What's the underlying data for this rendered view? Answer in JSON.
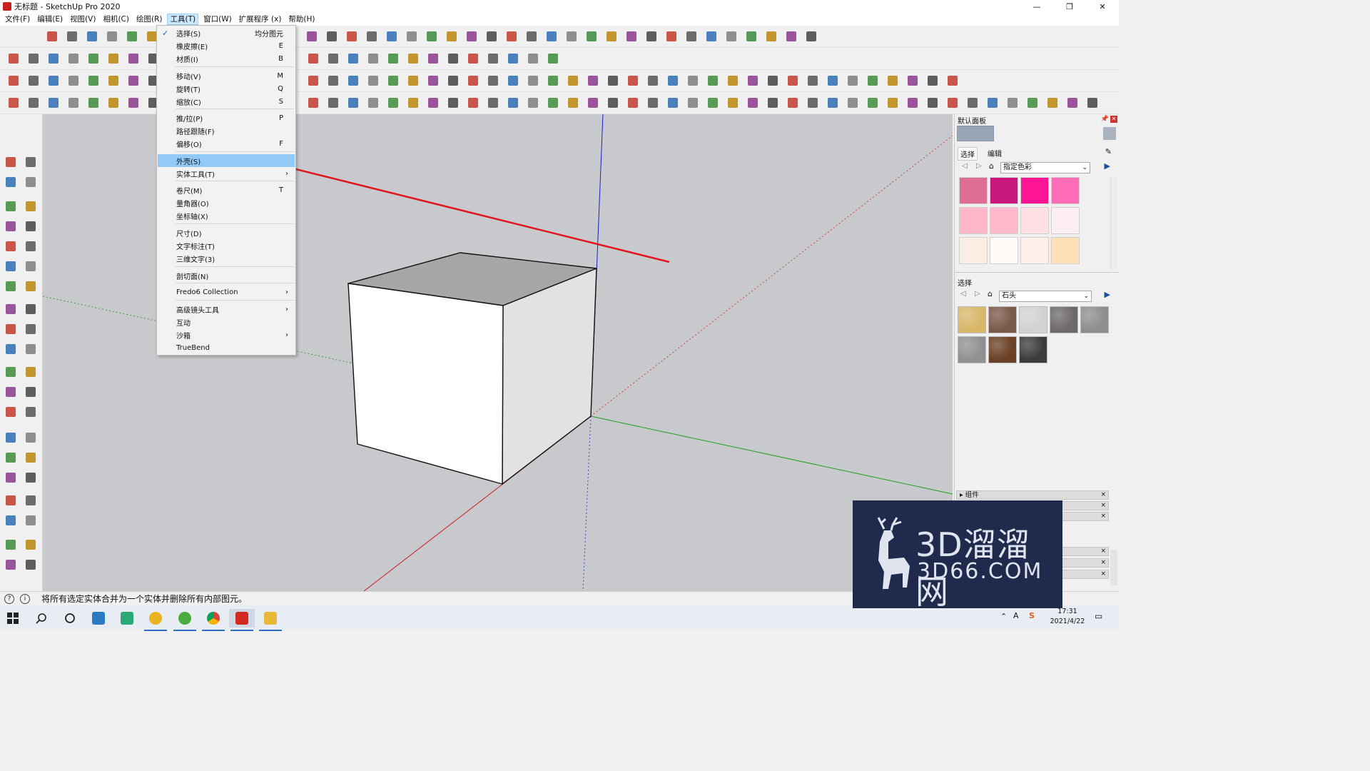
{
  "window": {
    "title": "无标题 - SketchUp Pro 2020",
    "minimize_glyph": "—",
    "restore_glyph": "❐",
    "close_glyph": "✕"
  },
  "menubar": [
    {
      "label": "文件(F)"
    },
    {
      "label": "编辑(E)"
    },
    {
      "label": "视图(V)"
    },
    {
      "label": "相机(C)"
    },
    {
      "label": "绘图(R)"
    },
    {
      "label": "工具(T)",
      "active": true
    },
    {
      "label": "窗口(W)"
    },
    {
      "label": "扩展程序 (x)"
    },
    {
      "label": "帮助(H)"
    }
  ],
  "tools_menu": {
    "items": [
      {
        "label": "选择(S)",
        "shortcut": "均分图元",
        "checked": true
      },
      {
        "label": "橡皮擦(E)",
        "shortcut": "E"
      },
      {
        "label": "材质(I)",
        "shortcut": "B"
      },
      {
        "label": "移动(V)",
        "shortcut": "M"
      },
      {
        "label": "旋转(T)",
        "shortcut": "Q"
      },
      {
        "label": "缩放(C)",
        "shortcut": "S"
      },
      {
        "label": "推/拉(P)",
        "shortcut": "P"
      },
      {
        "label": "路径跟随(F)",
        "shortcut": ""
      },
      {
        "label": "偏移(O)",
        "shortcut": "F"
      },
      {
        "label": "外壳(S)",
        "shortcut": "",
        "highlighted": true
      },
      {
        "label": "实体工具(T)",
        "shortcut": "",
        "submenu": true
      },
      {
        "label": "卷尺(M)",
        "shortcut": "T"
      },
      {
        "label": "量角器(O)",
        "shortcut": ""
      },
      {
        "label": "坐标轴(X)",
        "shortcut": ""
      },
      {
        "label": "尺寸(D)",
        "shortcut": ""
      },
      {
        "label": "文字标注(T)",
        "shortcut": ""
      },
      {
        "label": "三维文字(3)",
        "shortcut": ""
      },
      {
        "label": "剖切面(N)",
        "shortcut": ""
      },
      {
        "label": "Fredo6 Collection",
        "shortcut": "",
        "submenu": true
      },
      {
        "label": "高级镜头工具",
        "shortcut": "",
        "submenu": true
      },
      {
        "label": "互动",
        "shortcut": ""
      },
      {
        "label": "沙箱",
        "shortcut": "",
        "submenu": true
      },
      {
        "label": "TrueBend",
        "shortcut": ""
      }
    ],
    "check_glyph": "✓",
    "submenu_glyph": "›"
  },
  "right_panel": {
    "tray_title": "默认面板",
    "tabs": [
      "选择",
      "编辑"
    ],
    "colors_combo": "指定色彩",
    "select_label": "选择",
    "materials_combo": "石头",
    "color_swatches": [
      "#dd6d93",
      "#c8177e",
      "#ff1493",
      "#ff6db6",
      "#ffb6c9",
      "#ffb9cc",
      "#ffe0e3",
      "#ffeff5",
      "#fbeee3",
      "#fffaf6",
      "#fff0ea",
      "#ffe1b9"
    ],
    "stone_textures": [
      "#d9b76a",
      "#7a5a4a",
      "#d2d2d2",
      "#6e6a6a",
      "#8e8e8e",
      "#909090",
      "#6b4126",
      "#3c3c3c"
    ],
    "collapsed_trays": [
      {
        "label": "组件"
      }
    ]
  },
  "status_bar": {
    "message": "将所有选定实体合并为一个实体并删除所有内部图元。",
    "info_glyph": "i",
    "help_glyph": "?"
  },
  "taskbar": {
    "time": "17:31",
    "date": "2021/4/22"
  },
  "watermark": {
    "cn_text": "3D溜溜网",
    "en_text": "3D66.COM"
  }
}
